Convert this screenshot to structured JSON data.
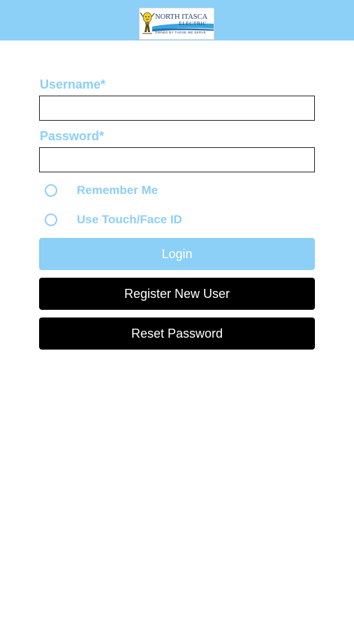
{
  "header": {
    "logo": {
      "line1": "NORTH ITASCA",
      "line2": "ELECTRIC",
      "tagline": "OWNED BY THOSE WE SERVE",
      "icon": "lightbulb-mascot-icon"
    },
    "background_color": "#8ccff7"
  },
  "form": {
    "username": {
      "label": "Username*",
      "value": "",
      "placeholder": ""
    },
    "password": {
      "label": "Password*",
      "value": "",
      "placeholder": ""
    },
    "remember_me": {
      "label": "Remember Me",
      "checked": false
    },
    "touch_face_id": {
      "label": "Use Touch/Face ID",
      "checked": false
    }
  },
  "buttons": {
    "login": "Login",
    "register": "Register New User",
    "reset": "Reset Password"
  },
  "colors": {
    "accent": "#8ccff7",
    "primary_button": "#000000",
    "button_text": "#ffffff"
  }
}
